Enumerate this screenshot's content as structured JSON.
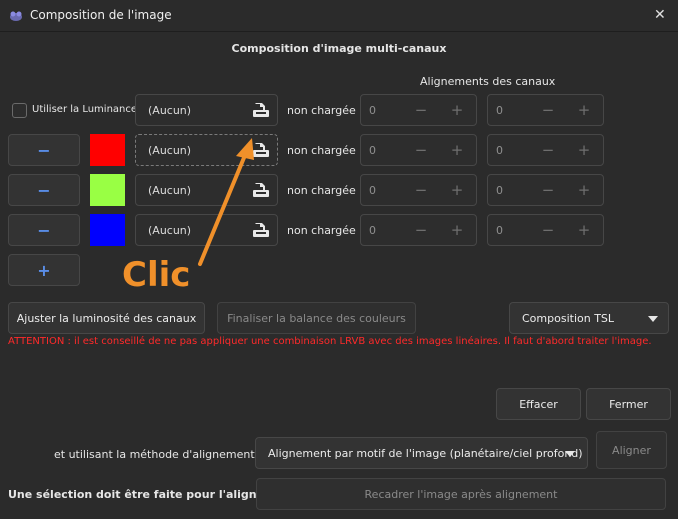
{
  "window": {
    "title": "Composition de l'image",
    "close_glyph": "✕"
  },
  "section_title": "Composition d'image multi-canaux",
  "alignment_header": "Alignements des canaux",
  "luminance": {
    "checkbox_label": "Utiliser la Luminance",
    "file_value": "(Aucun)",
    "status": "non chargée",
    "x_offset": "0",
    "y_offset": "0"
  },
  "channels": [
    {
      "color": "#ff0000",
      "file_value": "(Aucun)",
      "status": "non chargée",
      "x_offset": "0",
      "y_offset": "0"
    },
    {
      "color": "#99ff44",
      "file_value": "(Aucun)",
      "status": "non chargée",
      "x_offset": "0",
      "y_offset": "0"
    },
    {
      "color": "#0000ff",
      "file_value": "(Aucun)",
      "status": "non chargée",
      "x_offset": "0",
      "y_offset": "0"
    }
  ],
  "spin_minus": "−",
  "spin_plus": "+",
  "remove_glyph": "−",
  "add_glyph": "+",
  "annotation": {
    "text": "Clic",
    "color": "#f0902a"
  },
  "buttons": {
    "adjust_brightness": "Ajuster la luminosité des canaux",
    "finalize_balance": "Finaliser la balance des couleurs",
    "composition_mode": "Composition TSL",
    "clear": "Effacer",
    "close": "Fermer",
    "align": "Aligner",
    "recrop": "Recadrer l'image après alignement"
  },
  "warning": "ATTENTION : il est conseillé de ne pas appliquer une combinaison LRVB avec des images linéaires. Il faut d'abord traiter l'image.",
  "alignment": {
    "method_label": "et utilisant la méthode d'alignement :",
    "method_value": "Alignement par motif de l'image (planétaire/ciel profond)",
    "selection_note": "Une sélection doit être faite pour l'alignement"
  }
}
